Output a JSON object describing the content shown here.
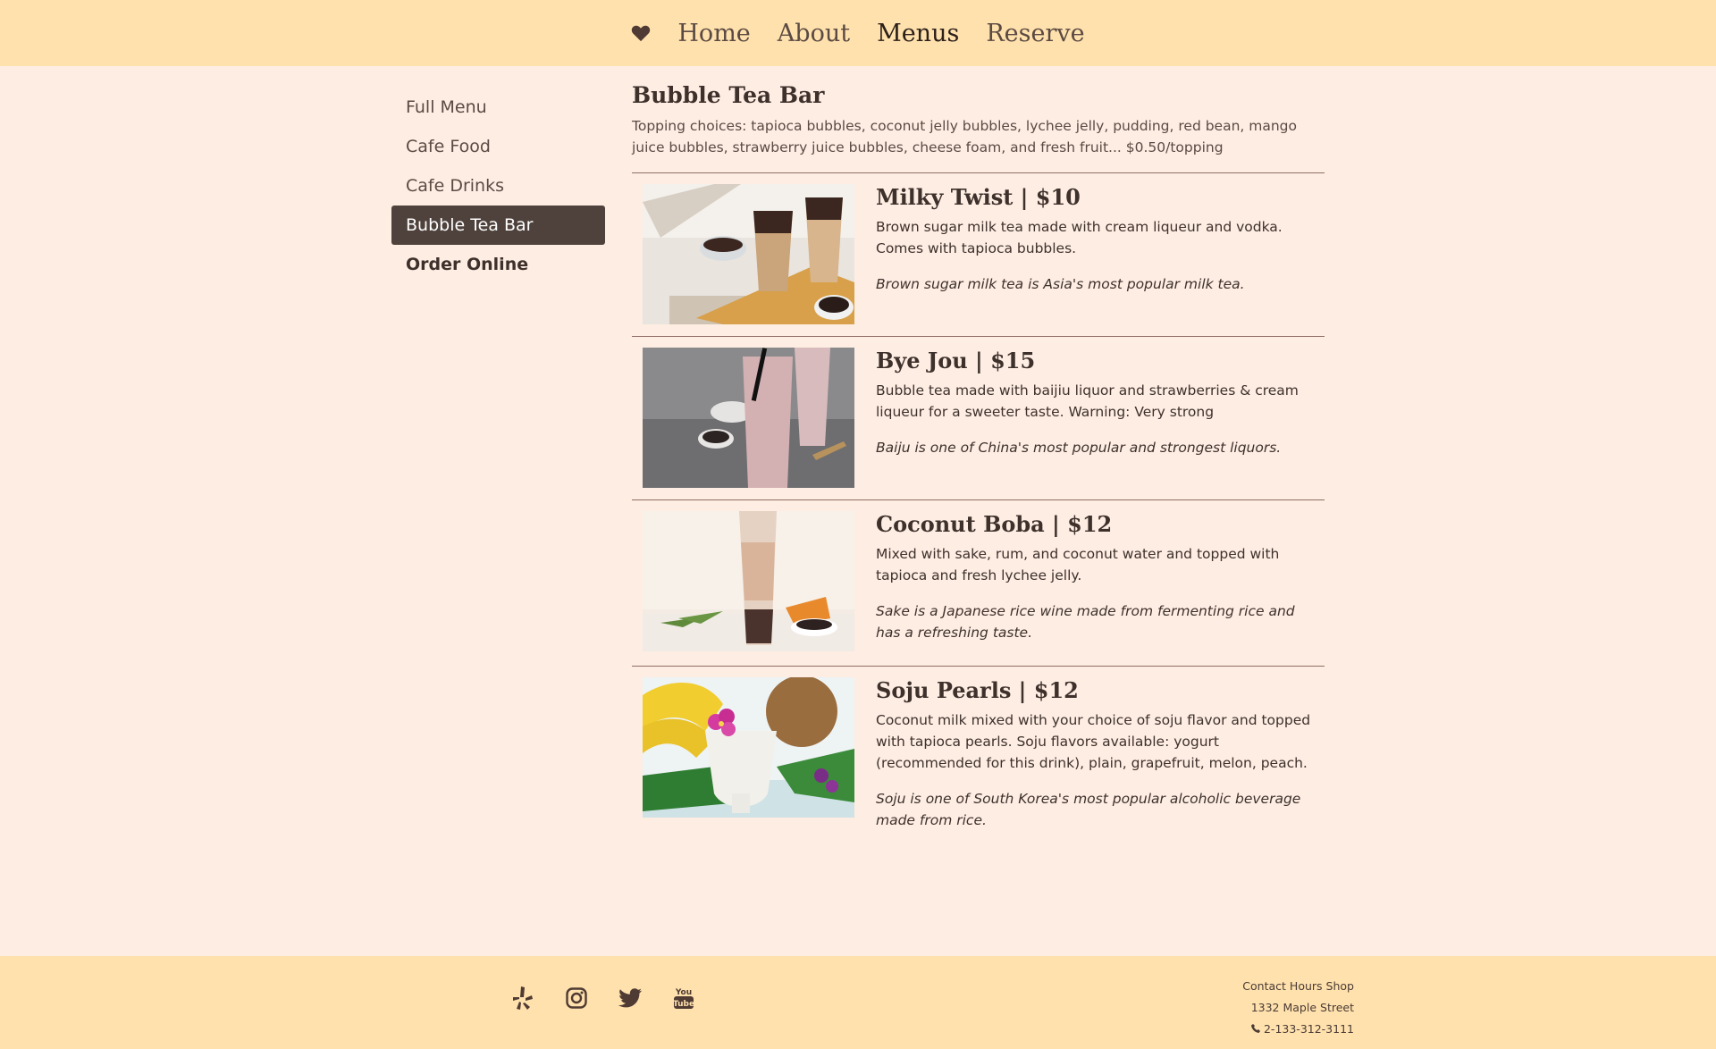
{
  "nav": {
    "icon": "heart-icon",
    "items": [
      {
        "label": "Home"
      },
      {
        "label": "About"
      },
      {
        "label": "Menus",
        "active": true
      },
      {
        "label": "Reserve"
      }
    ]
  },
  "sidebar": {
    "items": [
      {
        "label": "Full Menu"
      },
      {
        "label": "Cafe Food"
      },
      {
        "label": "Cafe Drinks"
      },
      {
        "label": "Bubble Tea Bar",
        "active": true
      },
      {
        "label": "Order Online",
        "bold": true
      }
    ]
  },
  "section": {
    "title": "Bubble Tea Bar",
    "description": "Topping choices: tapioca bubbles, coconut jelly bubbles, lychee jelly, pudding, red bean, mango juice bubbles, strawberry juice bubbles, cheese foam, and fresh fruit... $0.50/topping"
  },
  "menu_items": [
    {
      "title": "Milky Twist | $10",
      "description": "Brown sugar milk tea made with cream liqueur and vodka. Comes with tapioca bubbles.",
      "note": "Brown sugar milk tea is Asia's most popular milk tea."
    },
    {
      "title": "Bye Jou | $15",
      "description": "Bubble tea made with baijiu liquor and strawberries & cream liqueur for a sweeter taste. Warning: Very strong",
      "note": "Baiju is one of China's most popular and strongest liquors."
    },
    {
      "title": "Coconut Boba | $12",
      "description": "Mixed with sake, rum, and coconut water and topped with tapioca and fresh lychee jelly.",
      "note": "Sake is a Japanese rice wine made from fermenting rice and has a refreshing taste."
    },
    {
      "title": "Soju Pearls | $12",
      "description": "Coconut milk mixed with your choice of soju flavor and topped with tapioca pearls. Soju flavors available: yogurt (recommended for this drink), plain, grapefruit, melon, peach.",
      "note": "Soju is one of South Korea's most popular alcoholic beverage made from rice."
    }
  ],
  "footer": {
    "social": [
      "yelp-icon",
      "instagram-icon",
      "twitter-icon",
      "youtube-icon"
    ],
    "links": {
      "contact": "Contact",
      "hours": "Hours",
      "shop": "Shop"
    },
    "address": "1332 Maple Street",
    "phone": "2-133-312-3111"
  }
}
